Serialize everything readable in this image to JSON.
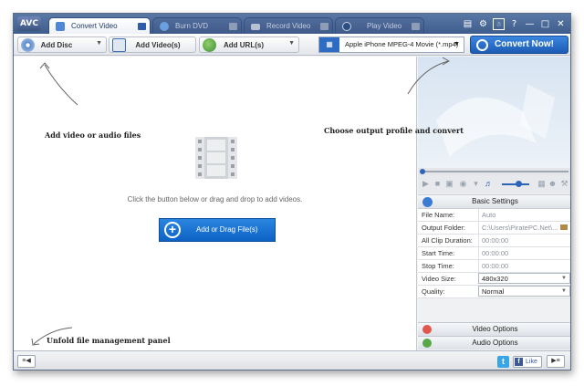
{
  "app": {
    "logo": "AVC"
  },
  "tabs": [
    {
      "label": "Convert Video",
      "active": true
    },
    {
      "label": "Burn DVD",
      "active": false
    },
    {
      "label": "Record Video",
      "active": false
    },
    {
      "label": "Play Video",
      "active": false
    }
  ],
  "window_buttons": [
    "menu-icon",
    "gear-icon",
    "skin-icon",
    "help-icon",
    "minimize-icon",
    "maximize-icon",
    "close-icon"
  ],
  "toolbar": {
    "add_disc": "Add Disc",
    "add_videos": "Add Video(s)",
    "add_urls": "Add URL(s)",
    "profile": "Apple iPhone MPEG-4 Movie (*.mp4)",
    "convert": "Convert Now!"
  },
  "main": {
    "hint": "Click the button below or drag and drop to add videos.",
    "add_button": "Add or Drag File(s)"
  },
  "annotations": {
    "add_files": "Add video or audio files",
    "output": "Choose output profile and convert",
    "panel": "Unfold file management panel"
  },
  "settings": {
    "header": "Basic Settings",
    "rows": [
      {
        "key": "File Name:",
        "value": "Auto"
      },
      {
        "key": "Output Folder:",
        "value": "C:\\Users\\PiratePC.Net\\..."
      },
      {
        "key": "All Clip Duration:",
        "value": "00:00:00"
      },
      {
        "key": "Start Time:",
        "value": "00:00:00"
      },
      {
        "key": "Stop Time:",
        "value": "00:00:00"
      },
      {
        "key": "Video Size:",
        "value": "480x320"
      },
      {
        "key": "Quality:",
        "value": "Normal"
      }
    ],
    "video_options": "Video Options",
    "audio_options": "Audio Options"
  },
  "status": {
    "like": "Like"
  },
  "colors": {
    "accent": "#1c5cb4",
    "titlebar": "#4a6899"
  }
}
